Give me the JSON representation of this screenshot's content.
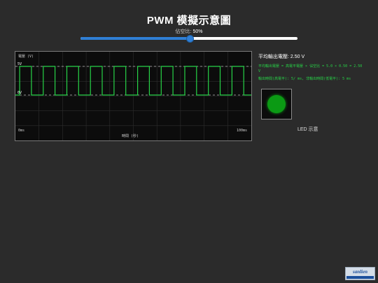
{
  "title": "PWM 模擬示意圖",
  "duty": {
    "label": "佔空比: ",
    "value": "50%",
    "fraction": 0.5
  },
  "scope": {
    "y_axis_label": "電壓 (V)",
    "x_axis_label": "時間 (秒)",
    "high_label": "5V",
    "low_label": "0V",
    "start_label": "0ms",
    "end_label": "100ms",
    "high_voltage": 5,
    "low_voltage": 0,
    "period_ms": 10,
    "window_ms": 100,
    "wave_color": "#27d347"
  },
  "info": {
    "avg_voltage": "平均輸出電壓: 2.50 V",
    "formula": "平均輸出電壓 = 高電平電壓 × 佔空比 = 5.0 × 0.50 = 2.50 V",
    "timing": "輸出時間(高電平): 5/ ms, 非輸出時間(低電平): 5 ms"
  },
  "led": {
    "caption": "LED 示意",
    "color": "#0b9a14"
  },
  "logo": {
    "text": "sanlien"
  }
}
